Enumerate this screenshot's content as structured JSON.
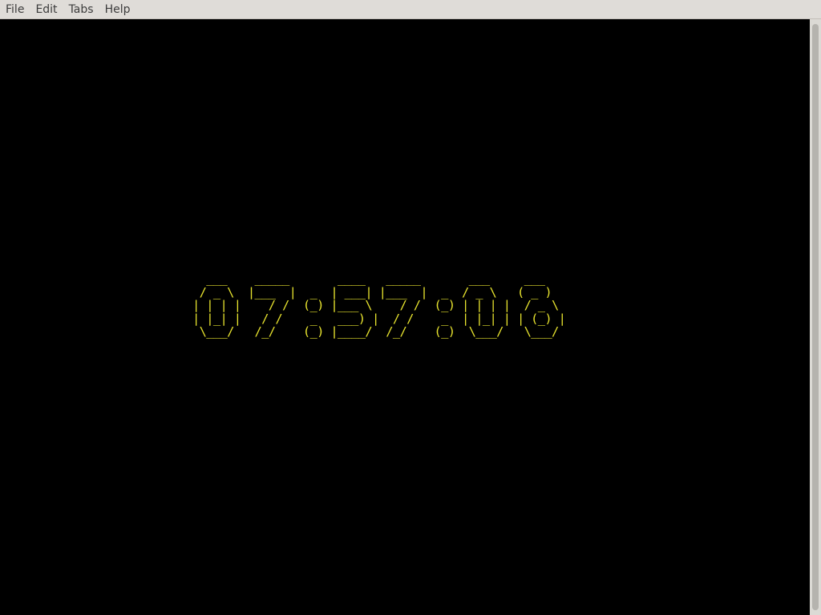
{
  "menubar": {
    "items": [
      "File",
      "Edit",
      "Tabs",
      "Help"
    ]
  },
  "terminal": {
    "background": "#000000",
    "text_color": "#e6e22e",
    "clock_time": "07:57:08",
    "clock_ascii": "  ___    _____       ____   _____       ___     ___  \n / _ \\  |___  |  _  | ___| |___  |  _  / _ \\   ( _ ) \n| | | |    / /  (_) |___ \\    / /  (_) | | | |  / _ \\ \n| |_| |   / /    _   ___) |  / /    _  | |_| | | (_) |\n \\___/   /_/    (_) |____/  /_/    (_)  \\___/   \\___/ "
  },
  "colors": {
    "menubar_bg": "#dfdcd8",
    "menu_text": "#3c3c3c",
    "scrollbar_track": "#dcdad5",
    "scrollbar_thumb": "#b5b3ae"
  }
}
